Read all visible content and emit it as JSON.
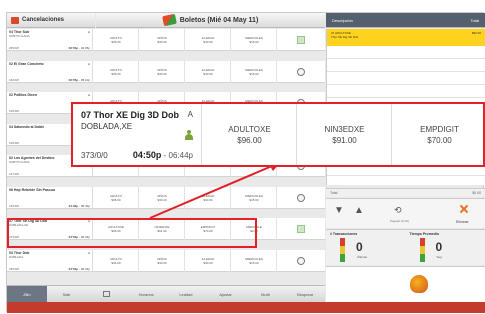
{
  "header": {
    "left_title": "Cancelaciones",
    "center_title": "Boletos (Mié 04 May 11)",
    "right_col_desc": "Descripción",
    "right_col_total": "Total"
  },
  "movies": [
    {
      "title": "04 Thor Sub",
      "dub": "SUBTITULADA",
      "count": "265/0/0",
      "time": "03:50p",
      "end": "- 04:35p",
      "rating": "A"
    },
    {
      "title": "02 El Gran Concierto",
      "dub": "",
      "count": "160/0/0",
      "time": "03:55p",
      "end": "- 05:10p",
      "rating": "A"
    },
    {
      "title": "02 Pollitos Dicen",
      "dub": "",
      "count": "160/0/0",
      "time": "",
      "end": "",
      "rating": "A"
    },
    {
      "title": "04 Saluendo al Doble",
      "dub": "",
      "count": "160/0/0",
      "time": "",
      "end": "",
      "rating": "A"
    },
    {
      "title": "02 Los Agentes del Destino",
      "dub": "SUBTITULADA",
      "count": "137/0/0",
      "time": "",
      "end": "",
      "rating": ""
    },
    {
      "title": "06 Hop Rebelde Sin Pascua",
      "dub": "",
      "count": "160/0/0",
      "time": "04:30p",
      "end": "- 05:40p",
      "rating": ""
    },
    {
      "title": "07 Thor XE Dig 3D Dob",
      "dub": "DOBLADA,XE",
      "count": "373/0/0",
      "time": "04:50p",
      "end": "- 06:44p",
      "rating": "A"
    },
    {
      "title": "03 Thor Dob",
      "dub": "DOBLADA",
      "count": "345/0/0",
      "time": "04:50p",
      "end": "- 06:44p",
      "rating": "A"
    }
  ],
  "prices": [
    [
      "ADULTO",
      "$36.00",
      "NIÑOS",
      "$30.00",
      "3A EDAD",
      "$30.00",
      "MIERCOLES",
      "$15.00"
    ],
    [
      "ADULTO",
      "$36.00",
      "NIÑOS",
      "$30.00",
      "3A EDAD",
      "$30.00",
      "MIERCOLES",
      "$15.00"
    ],
    [
      "ADULTO",
      "$36.00",
      "NIÑOS",
      "$30.00",
      "3A EDAD",
      "$30.00",
      "MIERCOLES",
      "$15.00"
    ],
    [
      "",
      "",
      "",
      "",
      "",
      "",
      "",
      ""
    ],
    [
      "",
      "",
      "",
      "",
      "",
      "",
      "",
      ""
    ],
    [
      "ADULTO",
      "$36.00",
      "NIÑOS",
      "$30.00",
      "3A EDAD",
      "$30.00",
      "MIERCOLES",
      "$15.00"
    ],
    [
      "ADULTOXE",
      "$96.00",
      "NIN3EDXE",
      "$91.00",
      "EMPDIGIT",
      "$70.00",
      "MIERCOLE",
      "$0.00"
    ],
    [
      "ADULTO",
      "$36.00",
      "NIÑOS",
      "$30.00",
      "3A EDAD",
      "$30.00",
      "MIERCOLES",
      "$15.00"
    ]
  ],
  "zoom": {
    "title": "07 Thor XE Dig 3D Dob",
    "dub": "DOBLADA,XE",
    "rating": "A",
    "count": "373/0/0",
    "time": "04:50p",
    "end": "- 06:44p",
    "prices": [
      {
        "label": "ADULTOXE",
        "value": "$96.00"
      },
      {
        "label": "NIN3EDXE",
        "value": "$91.00"
      },
      {
        "label": "EMPDIGIT",
        "value": "$70.00"
      }
    ]
  },
  "right_panel": {
    "selected_desc": "07 ADULTOXE",
    "selected_sub": "Thor XE Dig 3D Dob",
    "selected_total": "$96.00",
    "total_label": "Total",
    "total_value": "$0.00",
    "ctrl_label": "Pagado (0.00)",
    "elim_label": "Eliminar",
    "stat1_title": "# Transacciones",
    "stat1_value": "0",
    "stat1_unit": "Últimas",
    "stat2_title": "Tiempo Promedio",
    "stat2_value": "0",
    "stat2_unit": "Seg"
  },
  "footer": {
    "buttons": [
      "Zillo",
      "Salir",
      "",
      "Horarios",
      "Lealtad",
      "Ajustar",
      "Multi",
      "Bloquear"
    ]
  },
  "colors": {
    "accent": "#e32025",
    "selected": "#ffd21d",
    "statusbar": "#c33b2c"
  }
}
